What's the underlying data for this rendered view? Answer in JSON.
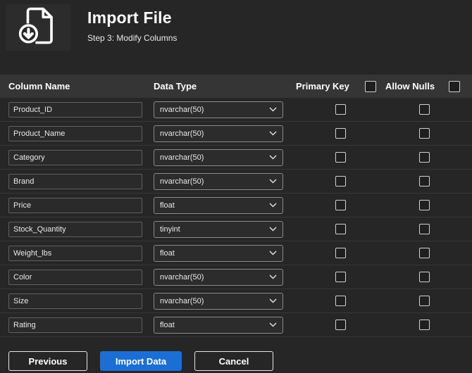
{
  "header": {
    "title": "Import File",
    "subtitle": "Step 3: Modify Columns"
  },
  "table": {
    "headers": {
      "column_name": "Column Name",
      "data_type": "Data Type",
      "primary_key": "Primary Key",
      "allow_nulls": "Allow Nulls"
    },
    "rows": [
      {
        "name": "Product_ID",
        "type": "nvarchar(50)",
        "primary_key": false,
        "allow_nulls": false
      },
      {
        "name": "Product_Name",
        "type": "nvarchar(50)",
        "primary_key": false,
        "allow_nulls": false
      },
      {
        "name": "Category",
        "type": "nvarchar(50)",
        "primary_key": false,
        "allow_nulls": false
      },
      {
        "name": "Brand",
        "type": "nvarchar(50)",
        "primary_key": false,
        "allow_nulls": false
      },
      {
        "name": "Price",
        "type": "float",
        "primary_key": false,
        "allow_nulls": false
      },
      {
        "name": "Stock_Quantity",
        "type": "tinyint",
        "primary_key": false,
        "allow_nulls": false
      },
      {
        "name": "Weight_lbs",
        "type": "float",
        "primary_key": false,
        "allow_nulls": false
      },
      {
        "name": "Color",
        "type": "nvarchar(50)",
        "primary_key": false,
        "allow_nulls": false
      },
      {
        "name": "Size",
        "type": "nvarchar(50)",
        "primary_key": false,
        "allow_nulls": false
      },
      {
        "name": "Rating",
        "type": "float",
        "primary_key": false,
        "allow_nulls": false
      }
    ]
  },
  "buttons": {
    "previous": "Previous",
    "import": "Import Data",
    "cancel": "Cancel"
  },
  "colors": {
    "accent": "#1b6fd4",
    "background": "#262626",
    "table_header": "#353535"
  }
}
